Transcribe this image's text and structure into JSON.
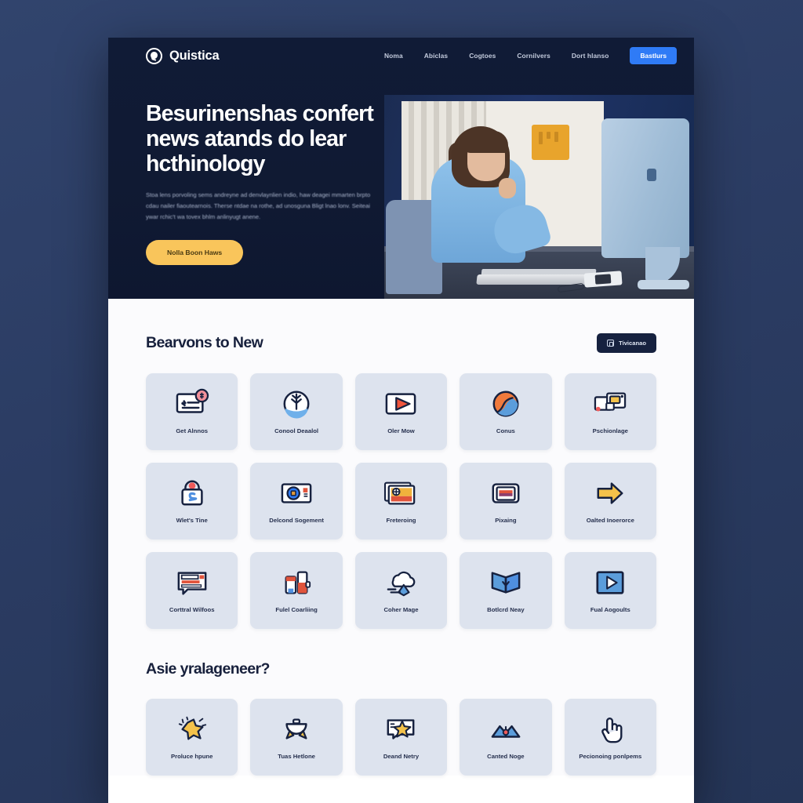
{
  "site": {
    "brand": "Quistica",
    "logo_icon": "globe-pin-logo-icon"
  },
  "nav": {
    "links": [
      {
        "label": "Noma",
        "icon": "nav-link-icon"
      },
      {
        "label": "Abiclas",
        "icon": "nav-link-icon"
      },
      {
        "label": "Cogtoes",
        "icon": "nav-link-icon"
      },
      {
        "label": "Cornilvers",
        "icon": "nav-link-icon"
      },
      {
        "label": "Dort hlanso",
        "icon": "nav-link-icon"
      }
    ],
    "cta_label": "Bastlurs"
  },
  "hero": {
    "title": "Besurinenshas confert news atands do lear hcthinology",
    "subtitle": "Stoa lens porvoling sems andreyne ad denvlaynlien indio, haw deagei mmarten brpto cdau nailer fiaoutearnois. Therse ntdae na rothe, ad unosguna Bligt lnao lonv. Seiteai ywar rchic't wa tovex bhlm anlinyugt anene.",
    "cta_label": "Nolla Boon Haws",
    "photo_alt": "woman-at-desk-photo"
  },
  "section1": {
    "title": "Bearvons to New",
    "action_label": "Tivicanao",
    "action_icon": "copy-icon",
    "cards": [
      {
        "label": "Get Alnnos",
        "icon": "card-with-badge-icon",
        "accent": "#ef5a5a"
      },
      {
        "label": "Conool Deaalol",
        "icon": "tree-circle-icon",
        "accent": "#4f9ae0"
      },
      {
        "label": "Oler Mow",
        "icon": "video-play-icon",
        "accent": "#f05a3c"
      },
      {
        "label": "Conus",
        "icon": "swirl-globe-icon",
        "accent": "#f07a3c"
      },
      {
        "label": "Pschionlage",
        "icon": "cards-stack-icon",
        "accent": "#f4c24a"
      },
      {
        "label": "Wlet's Tine",
        "icon": "lock-s-icon",
        "accent": "#ef5a5a"
      },
      {
        "label": "Delcond Sogement",
        "icon": "disc-card-icon",
        "accent": "#2f7bf6"
      },
      {
        "label": "Freteroing",
        "icon": "stacked-photo-icon",
        "accent": "#f0913c"
      },
      {
        "label": "Pixaing",
        "icon": "printer-icon",
        "accent": "#e0543c"
      },
      {
        "label": "Oalted Inoerorce",
        "icon": "arrow-right-icon",
        "accent": "#f4c24a"
      },
      {
        "label": "Corttral Wilfoos",
        "icon": "chat-lines-icon",
        "accent": "#e0543c"
      },
      {
        "label": "Fulel Coarliing",
        "icon": "bottles-icon",
        "accent": "#e0543c"
      },
      {
        "label": "Coher Mage",
        "icon": "cloud-pin-icon",
        "accent": "#4f9ae0"
      },
      {
        "label": "Botlcrd Neay",
        "icon": "open-book-icon",
        "accent": "#4f8fe0"
      },
      {
        "label": "Fual Aogoults",
        "icon": "play-square-icon",
        "accent": "#4f8fe0"
      }
    ]
  },
  "section2": {
    "title": "Asie yralageneer?",
    "cards": [
      {
        "label": "Proluce hpune",
        "icon": "star-burst-icon",
        "accent": "#f4c24a"
      },
      {
        "label": "Tuas Hetlone",
        "icon": "basket-icon",
        "accent": "#f4c24a"
      },
      {
        "label": "Deand Netry",
        "icon": "star-chat-icon",
        "accent": "#f4c24a"
      },
      {
        "label": "Canted Noge",
        "icon": "mountains-icon",
        "accent": "#4f8fe0"
      },
      {
        "label": "Pecionoing ponlpems",
        "icon": "pointing-hand-icon",
        "accent": "#17203c"
      }
    ]
  },
  "colors": {
    "page_bg": "#2b3c63",
    "hero_bg": "#101a33",
    "accent_blue": "#2f7bf6",
    "accent_yellow": "#f9c55b",
    "card_bg": "#dde3ee",
    "body_bg": "#fbfbfd",
    "ink": "#17203c"
  }
}
